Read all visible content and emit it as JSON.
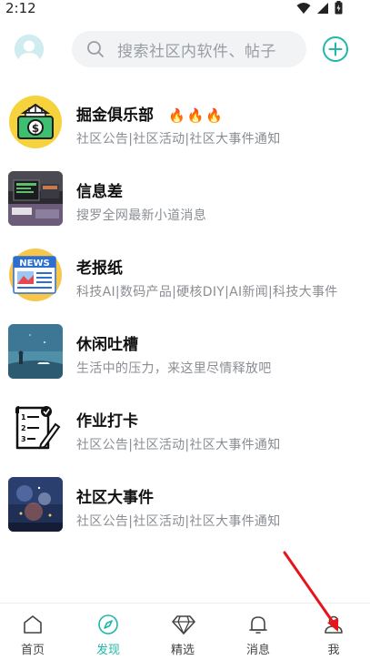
{
  "status_bar": {
    "time": "2:12"
  },
  "header": {
    "search_placeholder": "搜索社区内软件、帖子"
  },
  "communities": [
    {
      "name": "掘金俱乐部",
      "badge": "🔥🔥🔥",
      "desc": "社区公告|社区活动|社区大事件通知",
      "icon": "money-bank-icon"
    },
    {
      "name": "信息差",
      "badge": "",
      "desc": "搜罗全网最新小道消息",
      "icon": "computer-desk-photo"
    },
    {
      "name": "老报纸",
      "badge": "",
      "desc": "科技AI|数码产品|硬核DIY|AI新闻|科技大事件",
      "icon": "news-icon"
    },
    {
      "name": "休闲吐槽",
      "badge": "",
      "desc": "生活中的压力，来这里尽情释放吧",
      "icon": "night-sky-photo"
    },
    {
      "name": "作业打卡",
      "badge": "",
      "desc": "社区公告|社区活动|社区大事件通知",
      "icon": "checklist-icon"
    },
    {
      "name": "社区大事件",
      "badge": "",
      "desc": "社区公告|社区活动|社区大事件通知",
      "icon": "fireworks-photo"
    }
  ],
  "tabs": [
    {
      "label": "首页",
      "icon": "home-icon",
      "active": false
    },
    {
      "label": "发现",
      "icon": "compass-icon",
      "active": true
    },
    {
      "label": "精选",
      "icon": "diamond-icon",
      "active": false
    },
    {
      "label": "消息",
      "icon": "bell-icon",
      "active": false
    },
    {
      "label": "我",
      "icon": "user-icon",
      "active": false
    }
  ],
  "colors": {
    "accent": "#1fb8a9",
    "annotation_arrow": "#e8141b"
  }
}
